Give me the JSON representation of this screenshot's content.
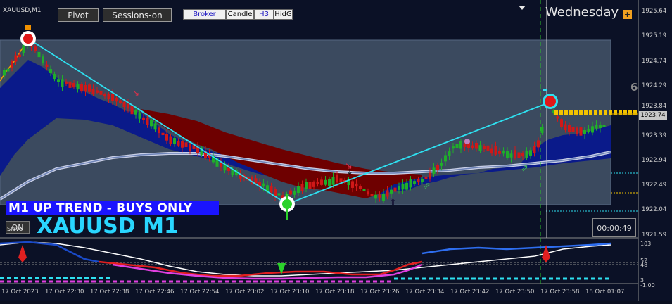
{
  "toolbar": {
    "symbol_small": "XAUUSD,M1",
    "pivot_label": "Pivot",
    "sessions_label": "Sessions-on",
    "pills": [
      "Broker",
      "Candle",
      "H3",
      "HidG"
    ]
  },
  "overlay": {
    "trend_banner": "M1 UP TREND - BUYS ONLY",
    "big_symbol": "XAUUSD M1",
    "on_label": "ON",
    "slave_label": "Slave",
    "day_label": "Wednesday",
    "day_plus": "+",
    "timer": "00:00:49",
    "side_number": "6",
    "current_price": "1923.74"
  },
  "price_axis": [
    "1925.64",
    "1925.19",
    "1924.74",
    "1924.29",
    "1923.84",
    "1923.39",
    "1922.94",
    "1922.49",
    "1922.04",
    "1921.59"
  ],
  "indicator_axis": [
    "103",
    "52",
    "48",
    "3",
    "-1.00"
  ],
  "time_axis": [
    "17 Oct 2023",
    "17 Oct 22:30",
    "17 Oct 22:38",
    "17 Oct 22:46",
    "17 Oct 22:54",
    "17 Oct 23:02",
    "17 Oct 23:10",
    "17 Oct 23:18",
    "17 Oct 23:26",
    "17 Oct 23:34",
    "17 Oct 23:42",
    "17 Oct 23:50",
    "17 Oct 23:58",
    "18 Oct 01:07"
  ],
  "colors": {
    "background": "#0b1126",
    "zone_fill": "#3b4a5f",
    "bull": "#1fae2a",
    "bear": "#d01818",
    "cloud_blue": "#0a1a8a",
    "cloud_red": "#6e0000",
    "trendline": "#2ee0f0",
    "banner": "#1a14ff",
    "price_line": "#f3c300"
  }
}
